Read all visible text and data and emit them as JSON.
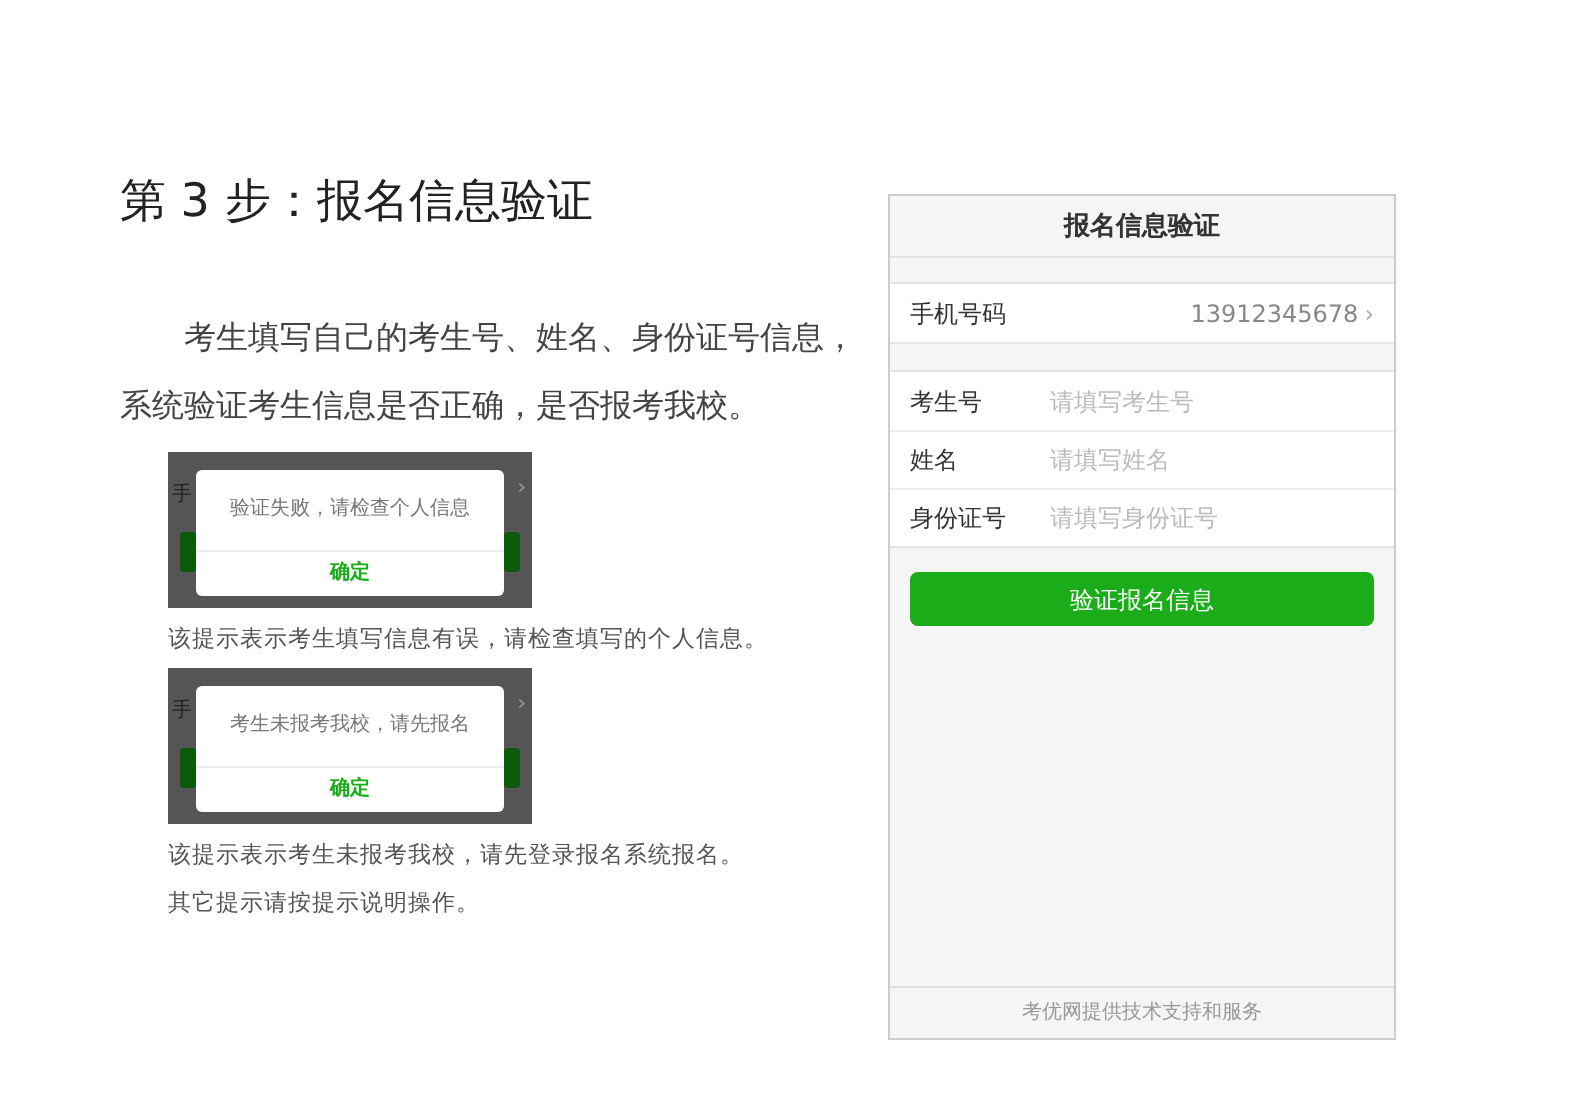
{
  "step_title": "第 3 步：报名信息验证",
  "intro": "考生填写自己的考生号、姓名、身份证号信息，系统验证考生信息是否正确，是否报考我校。",
  "examples": [
    {
      "behind_label": "手",
      "behind_chevron": "›",
      "message": "验证失败，请检查个人信息",
      "confirm": "确定",
      "caption": "该提示表示考生填写信息有误，请检查填写的个人信息。"
    },
    {
      "behind_label": "手",
      "behind_chevron": "›",
      "message": "考生未报考我校，请先报名",
      "confirm": "确定",
      "caption": "该提示表示考生未报考我校，请先登录报名系统报名。"
    }
  ],
  "note": "其它提示请按提示说明操作。",
  "phone": {
    "title": "报名信息验证",
    "phone_row": {
      "label": "手机号码",
      "value": "13912345678",
      "chevron": "›"
    },
    "fields": [
      {
        "label": "考生号",
        "placeholder": "请填写考生号"
      },
      {
        "label": "姓名",
        "placeholder": "请填写姓名"
      },
      {
        "label": "身份证号",
        "placeholder": "请填写身份证号"
      }
    ],
    "button": "验证报名信息",
    "footer": "考优网提供技术支持和服务"
  }
}
